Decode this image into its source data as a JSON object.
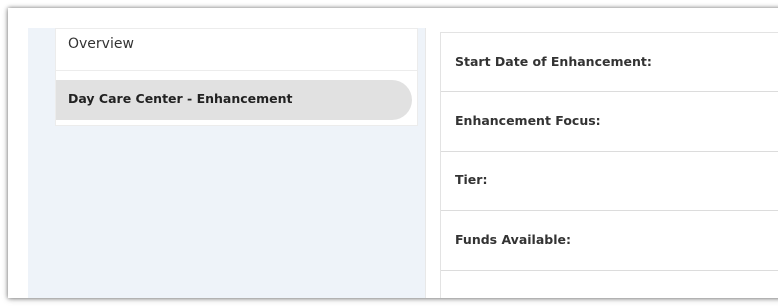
{
  "sidebar": {
    "items": [
      {
        "label": "Overview"
      },
      {
        "label": "Day Care Center - Enhancement"
      }
    ]
  },
  "details": {
    "fields": [
      {
        "label": "Start Date of Enhancement:"
      },
      {
        "label": "Enhancement Focus:"
      },
      {
        "label": "Tier:"
      },
      {
        "label": "Funds Available:"
      }
    ]
  },
  "colors": {
    "panel_background": "#eef3f9",
    "active_item_background": "#e1e1e1"
  }
}
